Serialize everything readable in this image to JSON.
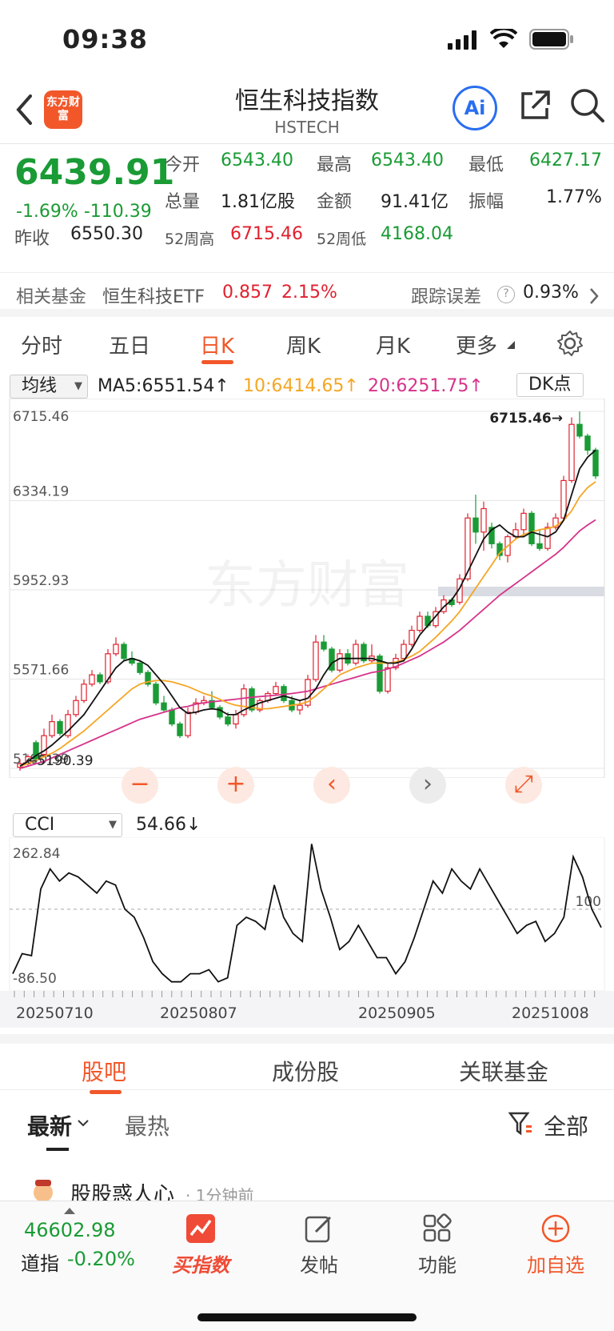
{
  "status": {
    "time": "09:38"
  },
  "nav": {
    "logo_text": "东方财富",
    "title": "恒生科技指数",
    "code": "HSTECH",
    "ai_label": "Ai"
  },
  "quote": {
    "price": "6439.91",
    "change_pct": "-1.69%",
    "change": "-110.39",
    "open_label": "今开",
    "open": "6543.40",
    "high_label": "最高",
    "high": "6543.40",
    "low_label": "最低",
    "low": "6427.17",
    "volume_label": "总量",
    "volume": "1.81亿股",
    "amount_label": "金额",
    "amount": "91.41亿",
    "amp_label": "振幅",
    "amp": "1.77%",
    "prev_label": "昨收",
    "prev": "6550.30",
    "w52h_label": "52周高",
    "w52h": "6715.46",
    "w52l_label": "52周低",
    "w52l": "4168.04"
  },
  "fund": {
    "label": "相关基金",
    "name": "恒生科技ETF",
    "price": "0.857",
    "pct": "2.15%",
    "track_label": "跟踪误差",
    "track_help": "?",
    "track": "0.93%"
  },
  "tabs": [
    "分时",
    "五日",
    "日K",
    "周K",
    "月K",
    "更多"
  ],
  "chart": {
    "ma_select": "均线",
    "ma5": "MA5:6551.54↑",
    "ma10": "10:6414.65↑",
    "ma20": "20:6251.75↑",
    "dk": "DK点",
    "price_ticks": [
      "6715.46",
      "6334.19",
      "5952.93",
      "5571.66",
      "5190.39"
    ],
    "max_label": "6715.46→",
    "min_label": "5190.39",
    "watermark": "东方财富",
    "ind_select": "CCI",
    "ind_value": "54.66↓",
    "ind_ticks": [
      "262.84",
      "-86.50"
    ],
    "ind_ref": "100",
    "dates": [
      "20250710",
      "20250807",
      "20250905",
      "20251008"
    ],
    "controls": [
      "−",
      "+",
      "‹",
      "›",
      "⤢"
    ]
  },
  "chart_data": {
    "type": "candlestick",
    "ylim": [
      5190.39,
      6715.46
    ],
    "candles": [
      [
        5195,
        5210,
        5180,
        5230
      ],
      [
        5210,
        5240,
        5200,
        5250
      ],
      [
        5300,
        5230,
        5220,
        5310
      ],
      [
        5250,
        5330,
        5240,
        5360
      ],
      [
        5330,
        5390,
        5320,
        5420
      ],
      [
        5390,
        5340,
        5330,
        5400
      ],
      [
        5330,
        5420,
        5320,
        5440
      ],
      [
        5420,
        5480,
        5410,
        5500
      ],
      [
        5480,
        5550,
        5470,
        5570
      ],
      [
        5550,
        5590,
        5540,
        5610
      ],
      [
        5590,
        5560,
        5550,
        5600
      ],
      [
        5560,
        5680,
        5550,
        5700
      ],
      [
        5680,
        5720,
        5670,
        5750
      ],
      [
        5720,
        5660,
        5650,
        5730
      ],
      [
        5660,
        5640,
        5630,
        5690
      ],
      [
        5640,
        5600,
        5590,
        5650
      ],
      [
        5600,
        5550,
        5540,
        5610
      ],
      [
        5550,
        5470,
        5460,
        5560
      ],
      [
        5470,
        5440,
        5430,
        5500
      ],
      [
        5440,
        5380,
        5370,
        5450
      ],
      [
        5380,
        5330,
        5320,
        5390
      ],
      [
        5330,
        5430,
        5320,
        5450
      ],
      [
        5430,
        5470,
        5420,
        5490
      ],
      [
        5470,
        5480,
        5460,
        5500
      ],
      [
        5480,
        5450,
        5440,
        5520
      ],
      [
        5450,
        5410,
        5400,
        5460
      ],
      [
        5410,
        5380,
        5370,
        5430
      ],
      [
        5380,
        5420,
        5360,
        5440
      ],
      [
        5420,
        5530,
        5410,
        5550
      ],
      [
        5530,
        5440,
        5430,
        5540
      ],
      [
        5440,
        5480,
        5430,
        5490
      ],
      [
        5480,
        5510,
        5470,
        5520
      ],
      [
        5510,
        5540,
        5500,
        5560
      ],
      [
        5540,
        5480,
        5470,
        5550
      ],
      [
        5480,
        5440,
        5430,
        5500
      ],
      [
        5440,
        5460,
        5420,
        5480
      ],
      [
        5460,
        5570,
        5450,
        5590
      ],
      [
        5570,
        5730,
        5560,
        5760
      ],
      [
        5730,
        5700,
        5690,
        5760
      ],
      [
        5700,
        5610,
        5600,
        5710
      ],
      [
        5610,
        5680,
        5600,
        5700
      ],
      [
        5680,
        5640,
        5630,
        5700
      ],
      [
        5640,
        5720,
        5630,
        5740
      ],
      [
        5720,
        5650,
        5640,
        5730
      ],
      [
        5650,
        5670,
        5640,
        5720
      ],
      [
        5670,
        5520,
        5510,
        5680
      ],
      [
        5520,
        5620,
        5510,
        5640
      ],
      [
        5620,
        5660,
        5610,
        5680
      ],
      [
        5660,
        5720,
        5650,
        5740
      ],
      [
        5720,
        5780,
        5710,
        5800
      ],
      [
        5780,
        5840,
        5770,
        5860
      ],
      [
        5840,
        5800,
        5790,
        5860
      ],
      [
        5800,
        5860,
        5790,
        5880
      ],
      [
        5860,
        5910,
        5850,
        5930
      ],
      [
        5910,
        5890,
        5880,
        5920
      ],
      [
        5900,
        6000,
        5890,
        6020
      ],
      [
        6000,
        6260,
        5990,
        6280
      ],
      [
        6260,
        6200,
        6150,
        6360
      ],
      [
        6200,
        6300,
        6120,
        6330
      ],
      [
        6220,
        6150,
        6130,
        6240
      ],
      [
        6150,
        6100,
        6080,
        6160
      ],
      [
        6100,
        6180,
        6070,
        6190
      ],
      [
        6180,
        6210,
        6170,
        6240
      ],
      [
        6210,
        6280,
        6180,
        6300
      ],
      [
        6280,
        6150,
        6140,
        6290
      ],
      [
        6150,
        6130,
        6120,
        6210
      ],
      [
        6130,
        6220,
        6120,
        6240
      ],
      [
        6220,
        6260,
        6210,
        6280
      ],
      [
        6260,
        6420,
        6250,
        6440
      ],
      [
        6420,
        6660,
        6410,
        6690
      ],
      [
        6660,
        6610,
        6600,
        6715
      ],
      [
        6610,
        6550,
        6530,
        6620
      ],
      [
        6550,
        6440,
        6427,
        6560
      ]
    ],
    "ma5": [
      5200,
      5220,
      5245,
      5265,
      5290,
      5320,
      5350,
      5385,
      5420,
      5470,
      5520,
      5570,
      5620,
      5650,
      5660,
      5650,
      5630,
      5590,
      5550,
      5500,
      5450,
      5425,
      5430,
      5440,
      5445,
      5440,
      5420,
      5420,
      5440,
      5455,
      5470,
      5480,
      5490,
      5500,
      5490,
      5480,
      5490,
      5530,
      5590,
      5640,
      5660,
      5660,
      5660,
      5660,
      5660,
      5650,
      5640,
      5640,
      5650,
      5700,
      5760,
      5800,
      5840,
      5880,
      5910,
      5960,
      6030,
      6100,
      6170,
      6210,
      6230,
      6200,
      6180,
      6180,
      6200,
      6190,
      6180,
      6200,
      6250,
      6360,
      6470,
      6520,
      6550
    ],
    "ma10": [
      5200,
      5210,
      5225,
      5240,
      5255,
      5275,
      5300,
      5325,
      5350,
      5380,
      5410,
      5440,
      5470,
      5500,
      5530,
      5550,
      5560,
      5565,
      5565,
      5560,
      5550,
      5540,
      5525,
      5510,
      5500,
      5485,
      5470,
      5460,
      5455,
      5450,
      5445,
      5445,
      5450,
      5455,
      5460,
      5465,
      5475,
      5500,
      5530,
      5560,
      5590,
      5605,
      5620,
      5630,
      5640,
      5640,
      5640,
      5645,
      5655,
      5670,
      5690,
      5720,
      5750,
      5785,
      5820,
      5860,
      5910,
      5960,
      6010,
      6060,
      6110,
      6140,
      6170,
      6190,
      6200,
      6210,
      6215,
      6225,
      6250,
      6290,
      6350,
      6390,
      6415
    ],
    "ma20": [
      5190,
      5200,
      5210,
      5220,
      5235,
      5250,
      5265,
      5280,
      5295,
      5310,
      5325,
      5340,
      5355,
      5370,
      5385,
      5400,
      5410,
      5420,
      5430,
      5440,
      5450,
      5455,
      5465,
      5470,
      5475,
      5478,
      5482,
      5486,
      5490,
      5494,
      5497,
      5500,
      5503,
      5506,
      5510,
      5515,
      5520,
      5530,
      5540,
      5550,
      5560,
      5570,
      5580,
      5590,
      5600,
      5605,
      5615,
      5625,
      5640,
      5655,
      5670,
      5690,
      5710,
      5730,
      5755,
      5780,
      5810,
      5840,
      5870,
      5900,
      5930,
      5955,
      5980,
      6005,
      6030,
      6055,
      6080,
      6105,
      6135,
      6170,
      6205,
      6230,
      6252
    ],
    "cci": [
      -60,
      -10,
      -15,
      150,
      200,
      170,
      190,
      180,
      160,
      140,
      170,
      160,
      100,
      80,
      30,
      -30,
      -60,
      -80,
      -80,
      -60,
      -60,
      -50,
      -80,
      -70,
      60,
      80,
      70,
      50,
      160,
      80,
      40,
      20,
      262,
      150,
      80,
      0,
      20,
      60,
      20,
      -20,
      -20,
      -60,
      -30,
      30,
      100,
      170,
      140,
      200,
      170,
      150,
      200,
      160,
      120,
      80,
      40,
      60,
      70,
      20,
      40,
      80,
      230,
      180,
      100,
      54.66
    ],
    "cci_ylim": [
      -86.5,
      262.84
    ]
  },
  "subtabs": [
    "股吧",
    "成份股",
    "关联基金"
  ],
  "filter": {
    "latest": "最新",
    "hot": "最热",
    "all": "全部"
  },
  "post": {
    "user": "股股惑人心",
    "time": "· 1分钟前"
  },
  "bottom": {
    "index_value": "46602.98",
    "index_name": "道指",
    "index_pct": "-0.20%",
    "items": [
      "买指数",
      "发帖",
      "功能",
      "加自选"
    ]
  }
}
